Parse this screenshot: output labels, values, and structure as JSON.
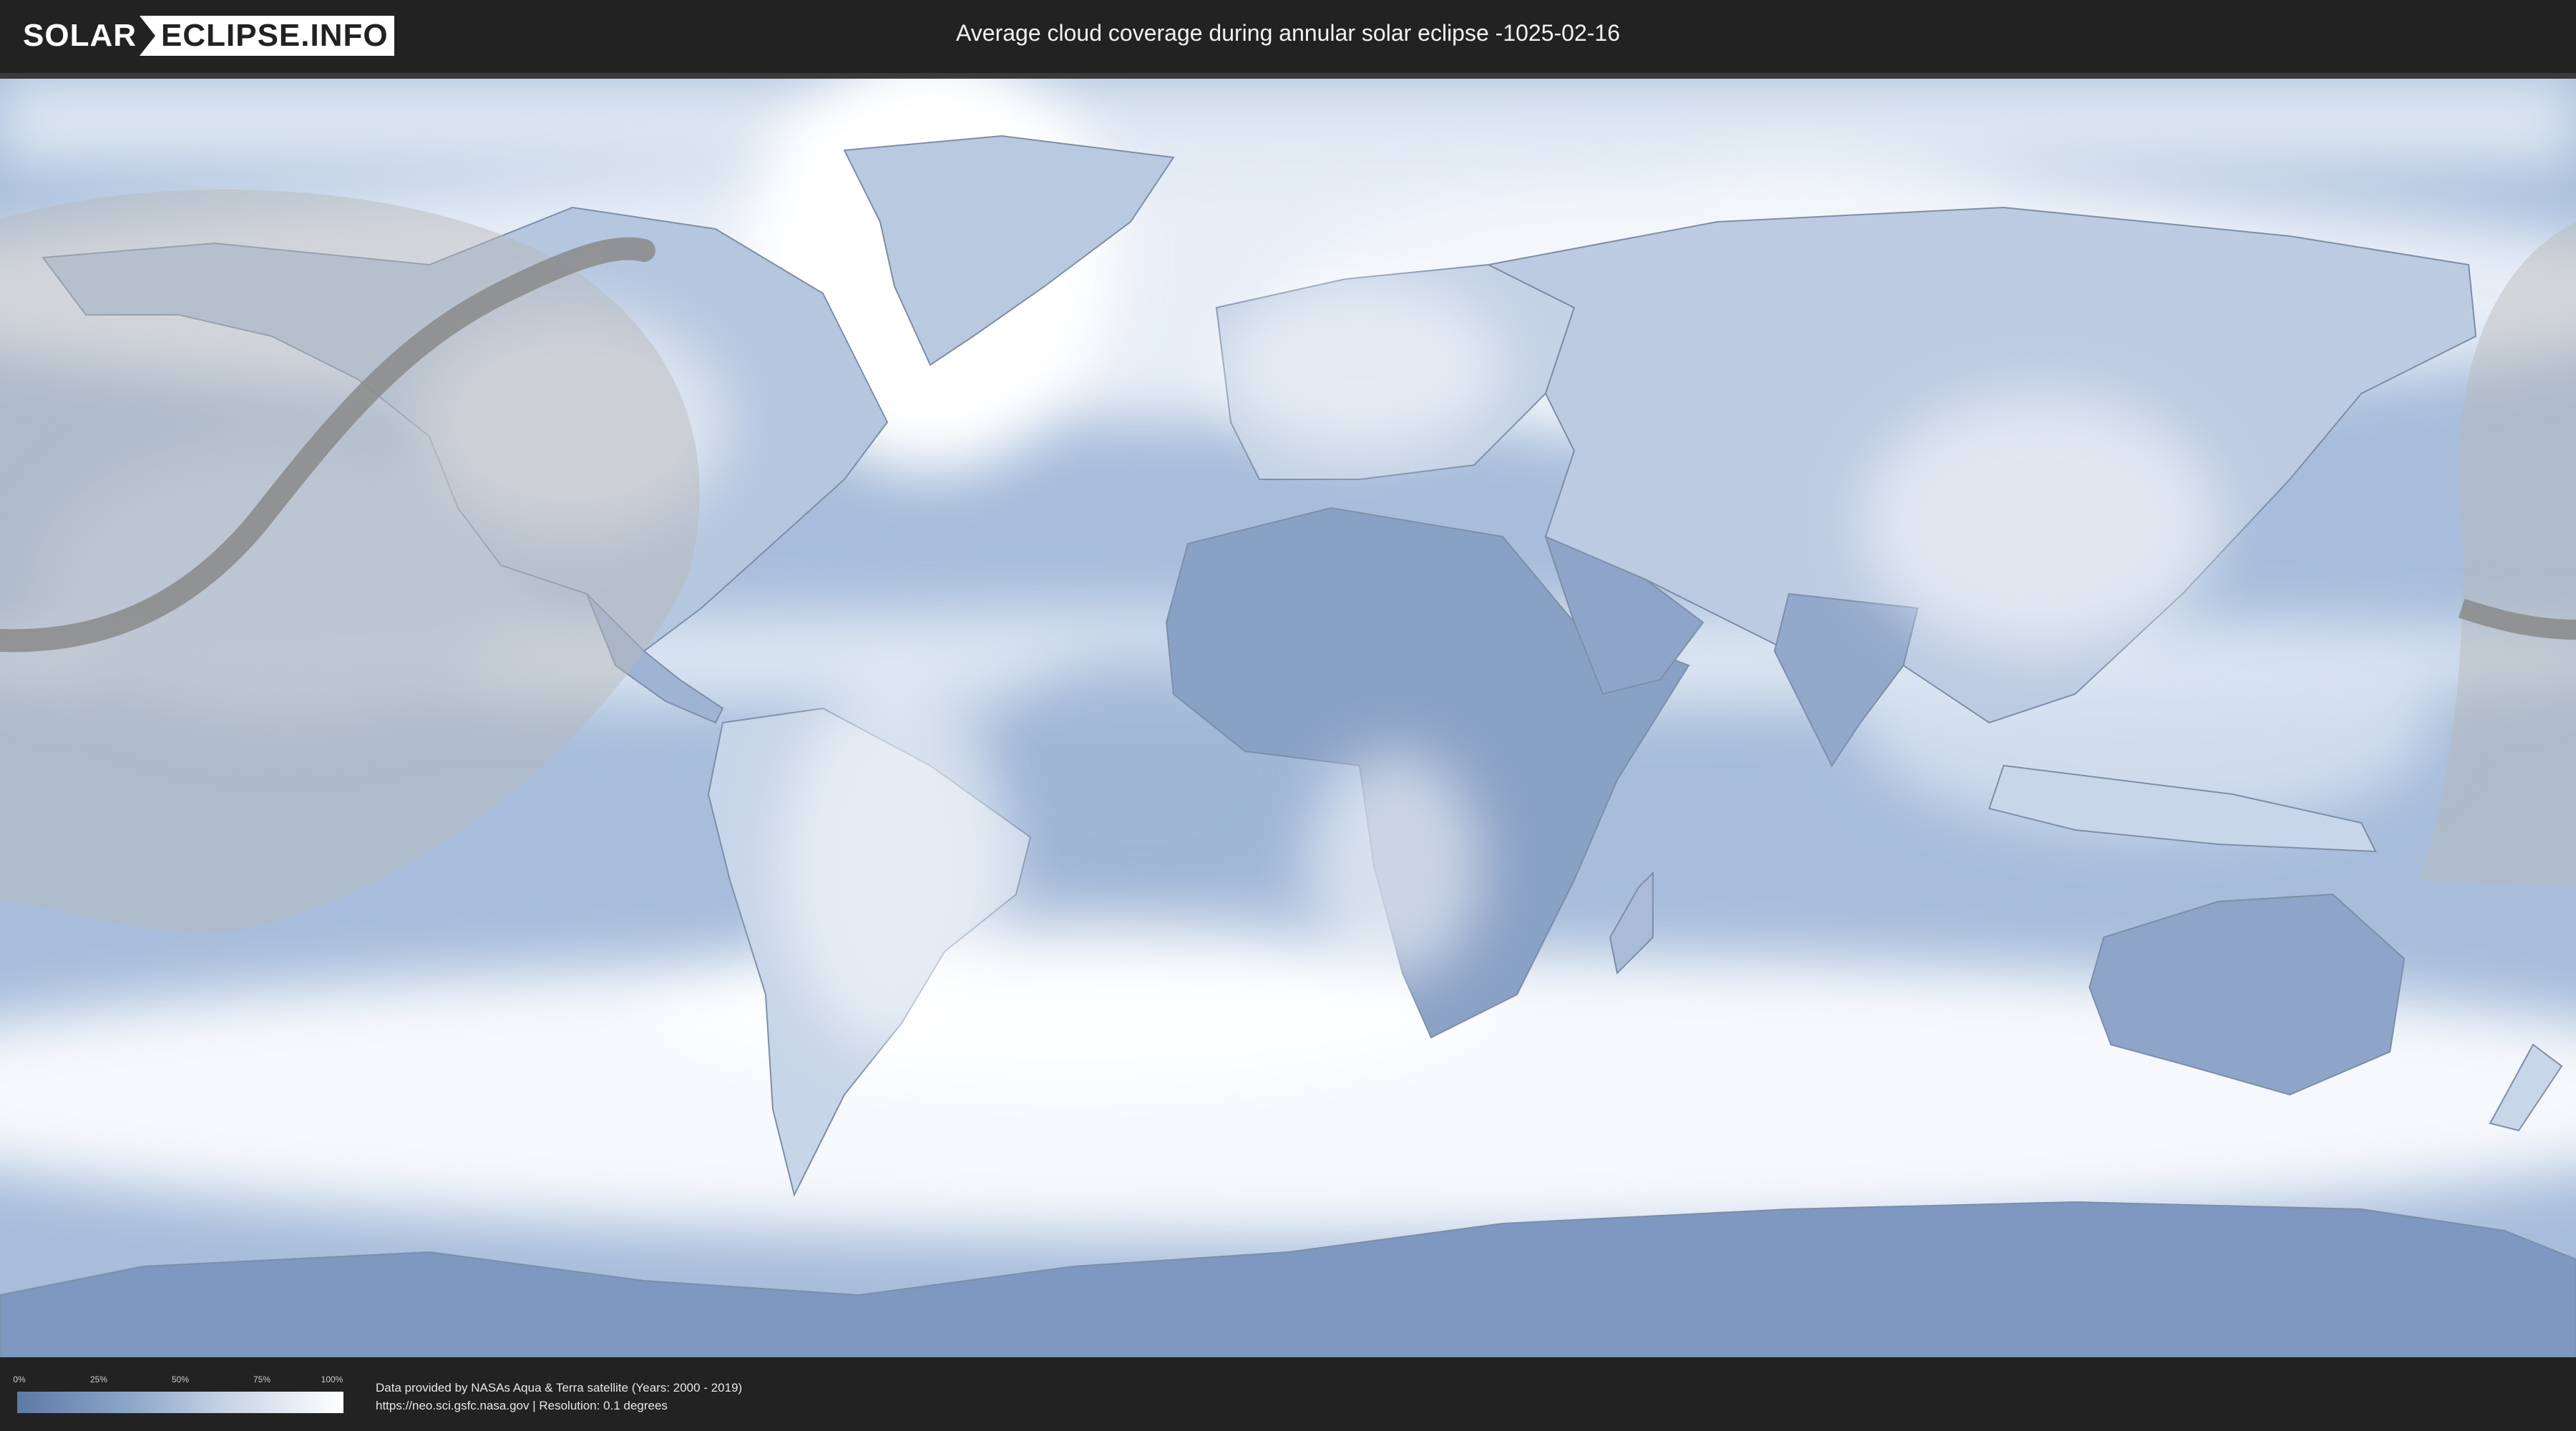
{
  "header": {
    "logo_left": "SOLAR",
    "logo_right": "ECLIPSE.INFO",
    "title": "Average cloud coverage during annular solar eclipse -1025-02-16"
  },
  "map": {
    "ocean_color": "#a6bcd9",
    "clear_color": "#5e7ba8",
    "cloud_color": "#ffffff",
    "eclipse_zone_color": "#b8b8b8",
    "path_color": "#8a8a8a",
    "border_color": "#6e7f99"
  },
  "legend": {
    "ticks": [
      "0%",
      "25%",
      "50%",
      "75%",
      "100%"
    ],
    "colors": [
      "#5c7aa8",
      "#ffffff"
    ]
  },
  "footer": {
    "credit_line1": "Data provided by NASAs Aqua & Terra satellite (Years: 2000 - 2019)",
    "credit_line2": "https://neo.sci.gsfc.nasa.gov | Resolution: 0.1 degrees"
  }
}
